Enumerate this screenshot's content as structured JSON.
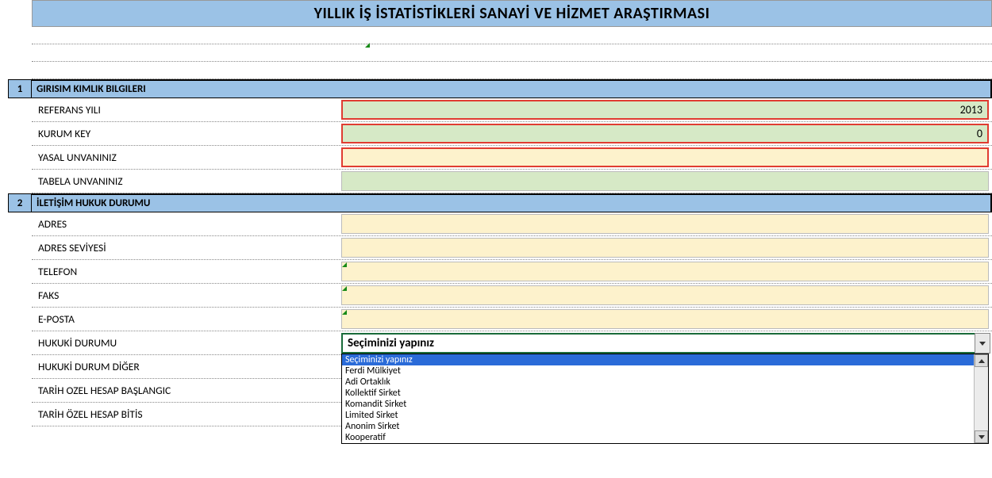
{
  "title": "YILLIK İŞ İSTATİSTİKLERİ SANAYİ VE HİZMET ARAŞTIRMASI",
  "sections": {
    "s1": {
      "num": "1",
      "title": "GIRISIM KIMLIK BILGILERI"
    },
    "s2": {
      "num": "2",
      "title": "İLETİŞİM HUKUK DURUMU"
    }
  },
  "rows": {
    "referans_yili": {
      "label": "REFERANS YILI",
      "value": "2013"
    },
    "kurum_key": {
      "label": "KURUM KEY",
      "value": "0"
    },
    "yasal_unvan": {
      "label": "YASAL UNVANINIZ",
      "value": ""
    },
    "tabela_unvan": {
      "label": "TABELA UNVANINIZ",
      "value": ""
    },
    "adres": {
      "label": "ADRES",
      "value": ""
    },
    "adres_seviyesi": {
      "label": "ADRES SEVİYESİ",
      "value": ""
    },
    "telefon": {
      "label": "TELEFON",
      "value": ""
    },
    "faks": {
      "label": "FAKS",
      "value": ""
    },
    "eposta": {
      "label": "E-POSTA",
      "value": ""
    },
    "hukuki_durumu": {
      "label": "HUKUKİ DURUMU"
    },
    "hukuki_diger": {
      "label": "HUKUKİ DURUM DİĞER"
    },
    "tarih_ozel_bas": {
      "label": "TARİH OZEL HESAP BAŞLANGIC"
    },
    "tarih_ozel_bit": {
      "label": "TARİH ÖZEL HESAP BİTİS"
    }
  },
  "select": {
    "current": "Seçiminizi yapınız",
    "options": [
      "Seçiminizi yapınız",
      "Ferdi Mülkiyet",
      "Adi Ortaklık",
      "Kollektif Sirket",
      "Komandit Sirket",
      "Limited Sirket",
      "Anonim Sirket",
      "Kooperatif"
    ]
  }
}
